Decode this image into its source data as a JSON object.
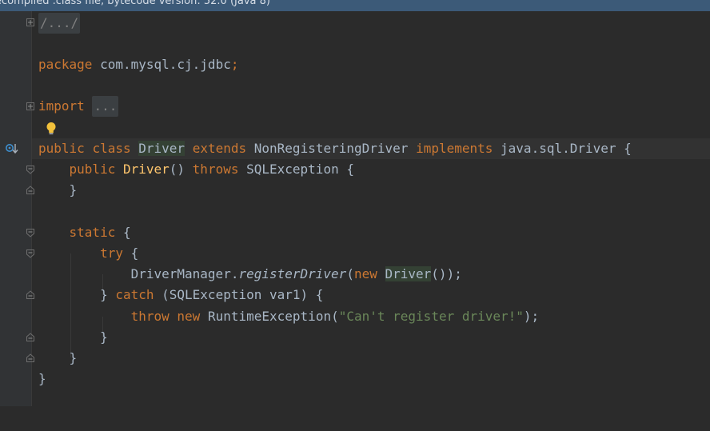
{
  "banner": {
    "text": "ecompiled .class file, bytecode version: 52.0 (Java 8)"
  },
  "code": {
    "fold_header": "/.../",
    "package_kw": "package",
    "package_name": " com.mysql.cj.jdbc",
    "semicolon": ";",
    "import_kw": "import",
    "import_folded": "...",
    "l_public": "public",
    "l_class": "class",
    "l_driver": "Driver",
    "l_extends": "extends",
    "l_super": "NonRegisteringDriver",
    "l_implements": "implements",
    "l_iface": "java.sql.Driver",
    "l_brace": " {",
    "ctor_public": "public",
    "ctor_name": "Driver",
    "ctor_parens": "()",
    "ctor_throws": "throws",
    "ctor_exc": "SQLException",
    "close_brace": "}",
    "static_kw": "static",
    "try_kw": "try",
    "dm": "DriverManager.",
    "register": "registerDriver",
    "lparen": "(",
    "new_kw": "new",
    "driver_ref": "Driver",
    "call_close": "());",
    "catch_close": "} ",
    "catch_kw": "catch",
    "catch_args": " (SQLException var1) {",
    "throw_kw": "throw",
    "rte": "RuntimeException(",
    "message": "\"Can't register driver!\"",
    "rparen_semi": ");"
  },
  "colors": {
    "keyword": "#cc7832",
    "function": "#ffc66d",
    "string": "#6a8759",
    "text": "#a9b7c6",
    "background": "#2b2b2b"
  },
  "icons": {
    "intention": "lightbulb-icon",
    "gutter": "implemented-method-icon"
  }
}
